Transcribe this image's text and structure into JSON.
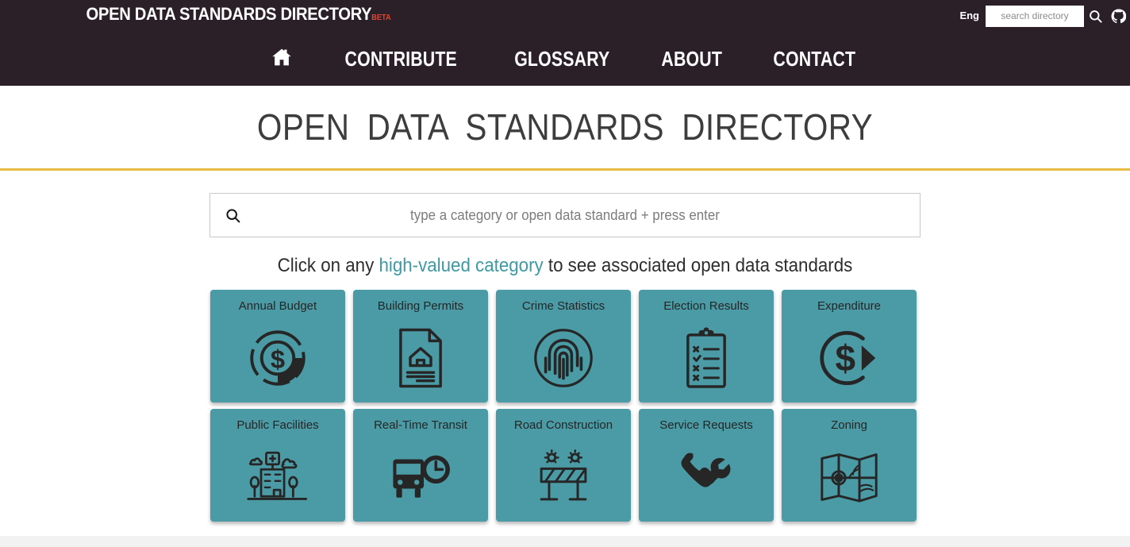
{
  "topbar": {
    "brand": "OPEN DATA STANDARDS DIRECTORY",
    "brand_badge": "BETA",
    "language": "Eng",
    "search_placeholder": "search directory",
    "search_value": "",
    "search_icon": "search-icon",
    "github_icon": "github-icon"
  },
  "nav": {
    "home_icon": "home-icon",
    "items": [
      {
        "label": "CONTRIBUTE"
      },
      {
        "label": "GLOSSARY"
      },
      {
        "label": "ABOUT"
      },
      {
        "label": "CONTACT"
      }
    ]
  },
  "hero": {
    "title": "OPEN  DATA  STANDARDS  DIRECTORY"
  },
  "main": {
    "search_icon": "search-icon",
    "search_placeholder": "type a category or open data standard + press enter",
    "search_value": "",
    "subtitle_before": "Click on any ",
    "subtitle_highlight": "high-valued category",
    "subtitle_after": " to see associated open data standards",
    "categories": [
      {
        "label": "Annual Budget",
        "icon": "pie-chart-dollar-icon"
      },
      {
        "label": "Building Permits",
        "icon": "document-house-icon"
      },
      {
        "label": "Crime Statistics",
        "icon": "fingerprint-icon"
      },
      {
        "label": "Election Results",
        "icon": "clipboard-checklist-icon"
      },
      {
        "label": "Expenditure",
        "icon": "dollar-circle-arrow-icon"
      },
      {
        "label": "Public Facilities",
        "icon": "hospital-building-icon"
      },
      {
        "label": "Real-Time Transit",
        "icon": "bus-clock-icon"
      },
      {
        "label": "Road Construction",
        "icon": "road-barricade-icon"
      },
      {
        "label": "Service Requests",
        "icon": "phone-wrench-icon"
      },
      {
        "label": "Zoning",
        "icon": "map-pin-icon"
      }
    ]
  },
  "colors": {
    "header_bg": "#2b2028",
    "tile_teal": "#4a9ba5",
    "accent_gold": "#e8bb45",
    "link_teal": "#3d9aa3",
    "beta_red": "#e8422e"
  }
}
